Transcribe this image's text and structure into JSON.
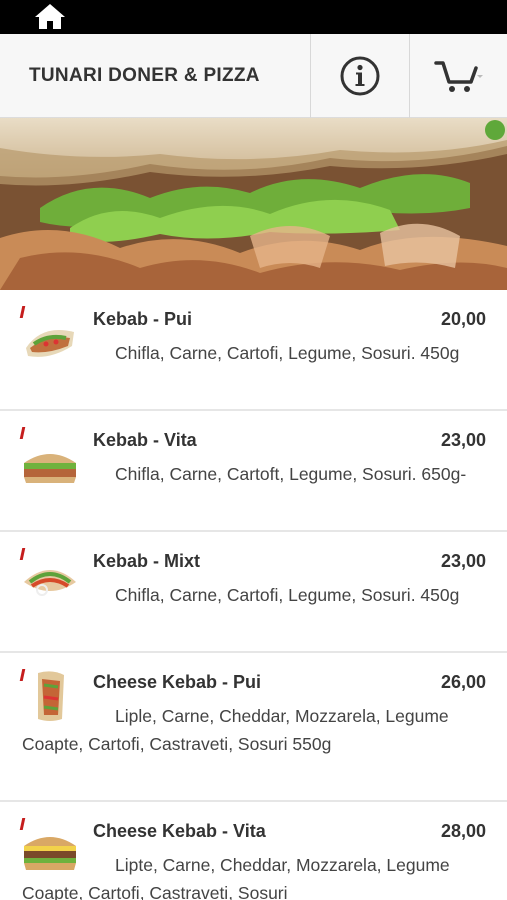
{
  "header": {
    "title": "TUNARI DONER & PIZZA"
  },
  "menu": {
    "items": [
      {
        "name": "Kebab - Pui",
        "price": "20,00",
        "description": "Chifla, Carne, Cartofi, Legume, Sosuri. 450g"
      },
      {
        "name": "Kebab - Vita",
        "price": "23,00",
        "description": "Chifla, Carne, Cartoft, Legume, Sosuri. 650g-"
      },
      {
        "name": "Kebab - Mixt",
        "price": "23,00",
        "description": "Chifla, Carne, Cartofi, Legume, Sosuri. 450g"
      },
      {
        "name": "Cheese Kebab - Pui",
        "price": "26,00",
        "description": "Liple, Carne, Cheddar, Mozzarela, Legume Coapte, Cartofi, Castraveti, Sosuri 550g"
      },
      {
        "name": "Cheese Kebab - Vita",
        "price": "28,00",
        "description": "Lipte, Carne, Cheddar, Mozzarela, Legume Coapte, Cartofi, Castraveti, Sosuri"
      }
    ]
  },
  "icons": {
    "home": "home-icon",
    "info": "info-icon",
    "cart": "cart-icon"
  },
  "colors": {
    "accent_red": "#c51d1d",
    "header_bg": "#f7f7f7",
    "statusbar_bg": "#000000"
  }
}
